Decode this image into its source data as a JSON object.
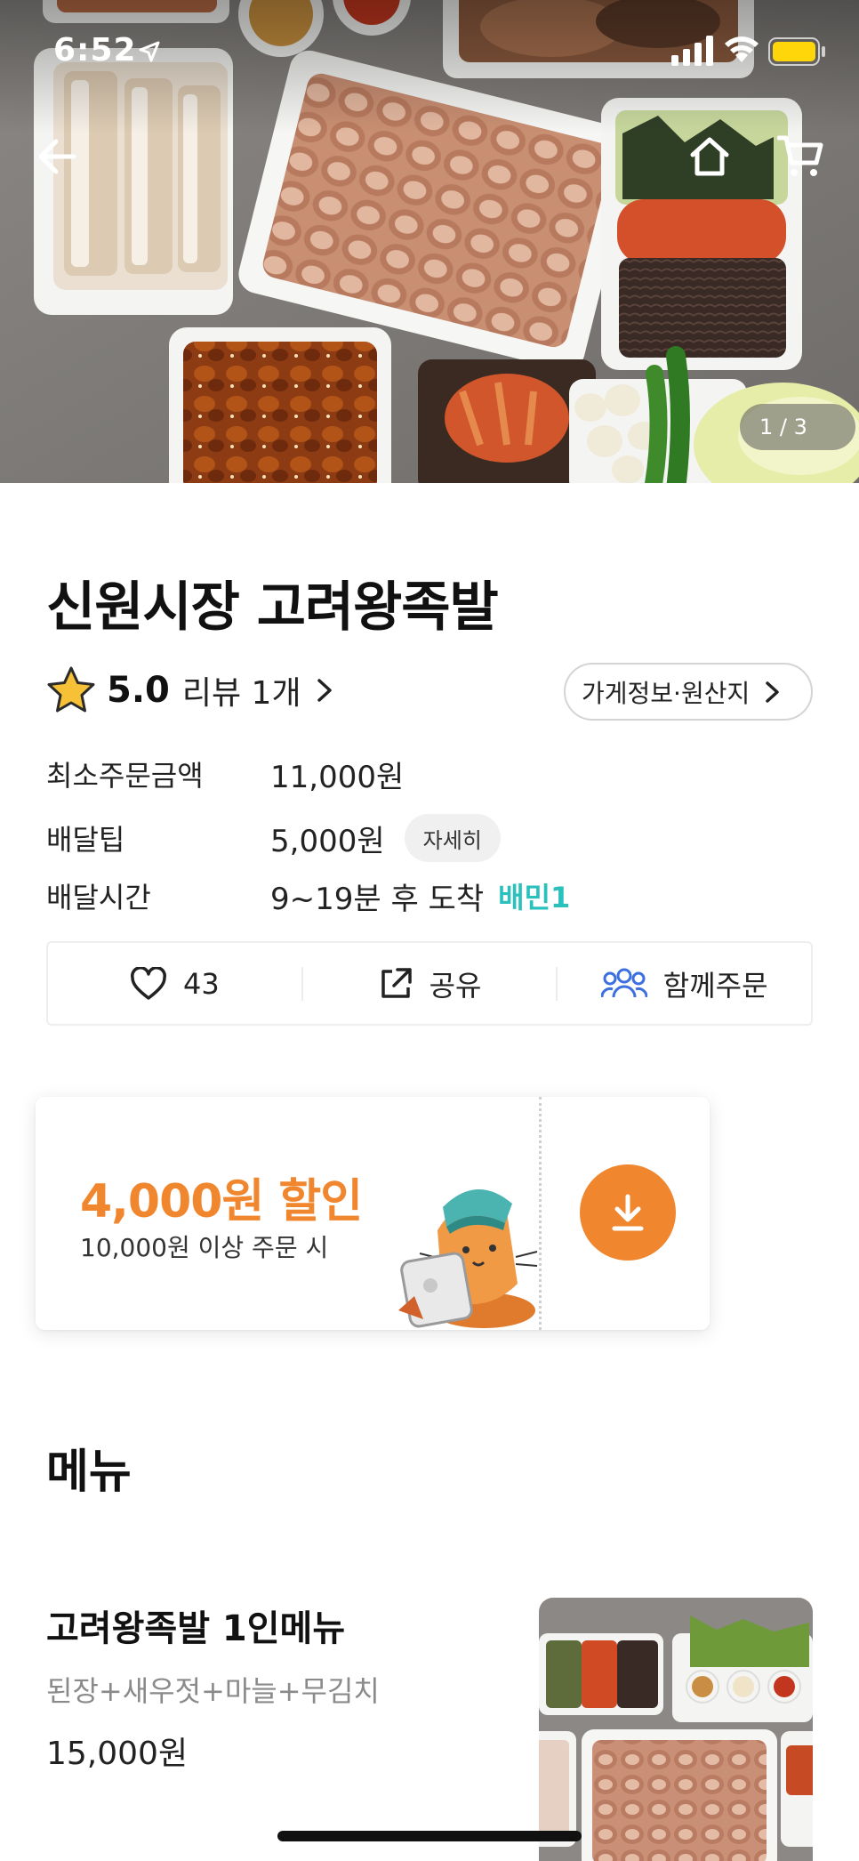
{
  "status_bar": {
    "time": "6:52"
  },
  "hero": {
    "photo_counter": "1 / 3",
    "icons": [
      "back-arrow-icon",
      "home-icon",
      "cart-icon"
    ]
  },
  "store": {
    "name": "신원시장 고려왕족발",
    "rating": "5.0",
    "review_link": "리뷰 1개",
    "info_button": "가게정보·원산지",
    "min_order_label": "최소주문금액",
    "min_order_value": "11,000원",
    "delivery_tip_label": "배달팁",
    "delivery_tip_value": "5,000원",
    "delivery_tip_detail": "자세히",
    "delivery_time_label": "배달시간",
    "delivery_time_value": "9~19분 후 도착",
    "baemin1_logo": "배민1"
  },
  "actions": {
    "like_count": "43",
    "share_label": "공유",
    "group_order_label": "함께주문"
  },
  "coupon": {
    "title": "4,000원 할인",
    "condition": "10,000원 이상 주문 시"
  },
  "menu": {
    "heading": "메뉴",
    "items": [
      {
        "name": "고려왕족발 1인메뉴",
        "description": "된장+새우젓+마늘+무김치",
        "price": "15,000원"
      }
    ]
  },
  "colors": {
    "accent_orange": "#f0862d",
    "baemin_mint": "#2ac1bc",
    "group_order_blue": "#3c6fe0",
    "star_yellow": "#f7c137"
  }
}
